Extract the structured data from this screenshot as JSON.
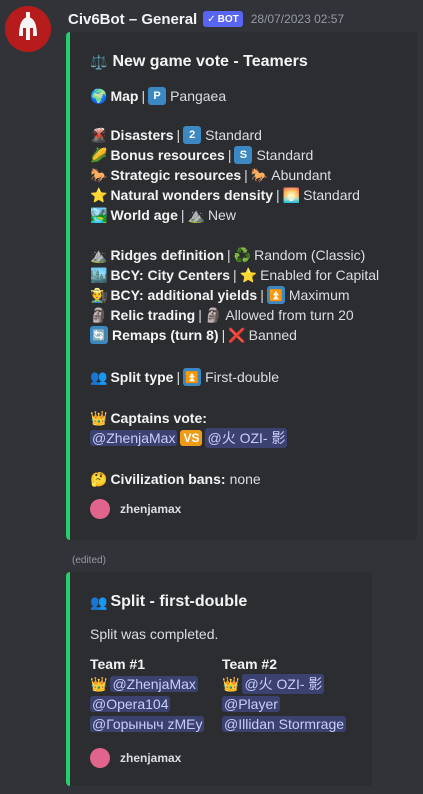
{
  "message": {
    "author": "Civ6Bot – General",
    "bot_tag": "BOT",
    "timestamp": "28/07/2023 02:57",
    "edited_label": "(edited)"
  },
  "vote": {
    "title": "New game vote - Teamers",
    "map_label": "Map",
    "map_value": "Pangaea",
    "disasters_label": "Disasters",
    "disasters_value": "Standard",
    "disasters_icon_text": "2",
    "bonus_label": "Bonus resources",
    "bonus_value": "Standard",
    "bonus_icon_text": "S",
    "strategic_label": "Strategic resources",
    "strategic_value": "Abundant",
    "wonders_label": "Natural wonders density",
    "wonders_value": "Standard",
    "worldage_label": "World age",
    "worldage_value": "New",
    "ridges_label": "Ridges definition",
    "ridges_value": "Random (Classic)",
    "bcy_centers_label": "BCY: City Centers",
    "bcy_centers_value": "Enabled for Capital",
    "bcy_yields_label": "BCY: additional yields",
    "bcy_yields_value": "Maximum",
    "relic_label": "Relic trading",
    "relic_value": "Allowed from turn 20",
    "remaps_label": "Remaps (turn 8)",
    "remaps_value": "Banned",
    "split_label": "Split type",
    "split_value": "First-double",
    "captains_label": "Captains vote:",
    "captain1": "@ZhenjaMax",
    "vs": "VS",
    "captain2": "@火 OZI- 影",
    "bans_label": "Civilization bans:",
    "bans_value": "none",
    "footer_name": "zhenjamax"
  },
  "split": {
    "title": "Split - first-double",
    "description": "Split was completed.",
    "team1_title": "Team #1",
    "team2_title": "Team #2",
    "team1": [
      "@ZhenjaMax",
      "@Opera104",
      "@Горыныч zMEy"
    ],
    "team2": [
      "@火 OZI- 影",
      "@Player",
      "@Illidan Stormrage"
    ],
    "footer_name": "zhenjamax"
  },
  "colors": {
    "background": "#313338",
    "embed_background": "#2b2d31",
    "embed_border": "#23d16a",
    "mention_bg": "#3c4270",
    "bot_tag": "#5865f2"
  }
}
